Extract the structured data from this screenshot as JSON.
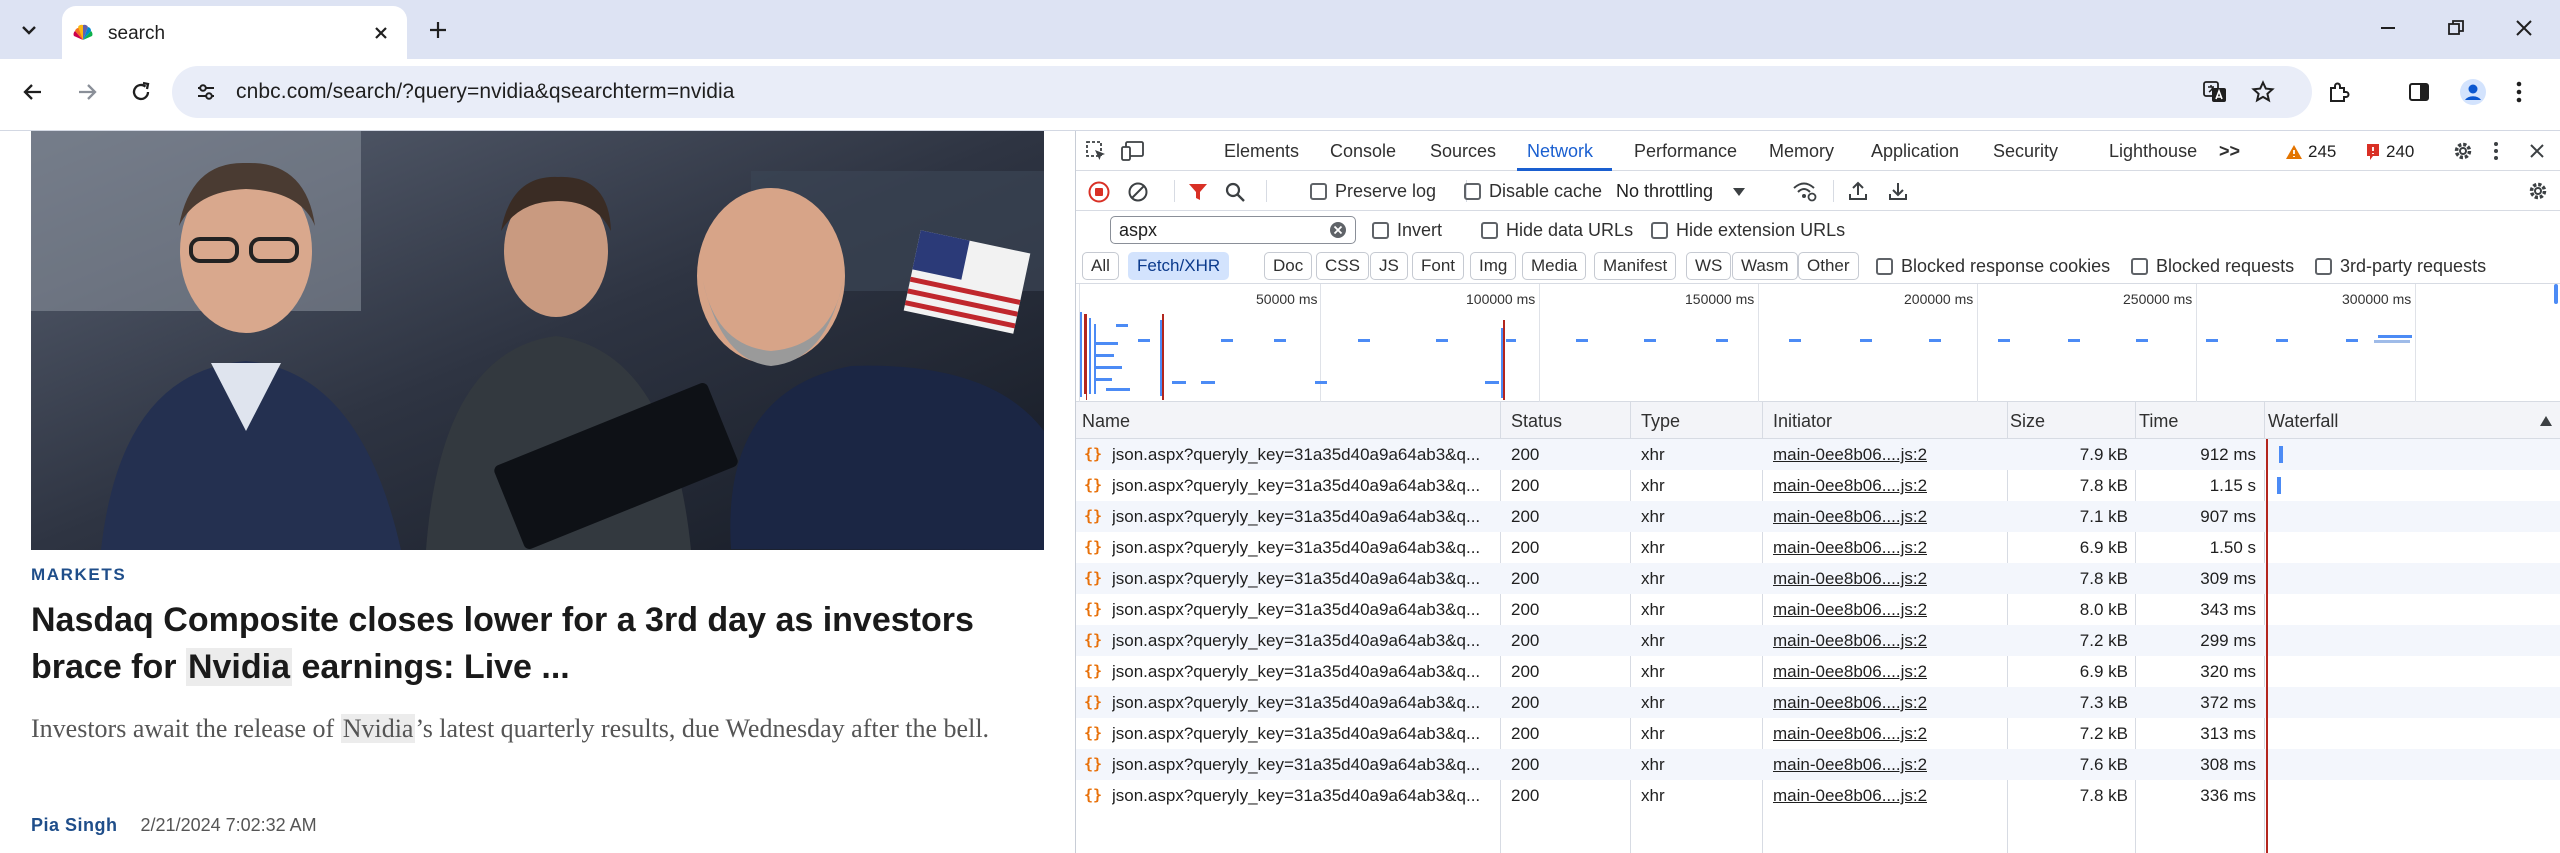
{
  "browser": {
    "tab": {
      "title": "search"
    },
    "url": "cnbc.com/search/?query=nvidia&qsearchterm=nvidia"
  },
  "article": {
    "category": "MARKETS",
    "headline_parts": [
      "Nasdaq Composite closes lower for a 3rd day as investors brace for ",
      "Nvidia",
      " earnings: Live ..."
    ],
    "description_parts": [
      "Investors await the release of ",
      "Nvidia",
      "’s latest quarterly results, due Wednesday after the bell."
    ],
    "author": "Pia Singh",
    "datetime": "2/21/2024 7:02:32 AM"
  },
  "devtools": {
    "tabs": [
      "Elements",
      "Console",
      "Sources",
      "Network",
      "Performance",
      "Memory",
      "Application",
      "Security",
      "Lighthouse"
    ],
    "active_tab": "Network",
    "more_tabs": ">>",
    "warnings_count": "245",
    "errors_count": "240",
    "toolbar": {
      "preserve_log": "Preserve log",
      "disable_cache": "Disable cache",
      "throttling": "No throttling"
    },
    "filter": {
      "value": "aspx",
      "invert": "Invert",
      "hide_data_urls": "Hide data URLs",
      "hide_extension_urls": "Hide extension URLs"
    },
    "type_filters": [
      "All",
      "Fetch/XHR",
      "Doc",
      "CSS",
      "JS",
      "Font",
      "Img",
      "Media",
      "Manifest",
      "WS",
      "Wasm",
      "Other"
    ],
    "active_type_filter": "Fetch/XHR",
    "blocked_response_cookies": "Blocked response cookies",
    "blocked_requests": "Blocked requests",
    "third_party_requests": "3rd-party requests",
    "overview_ticks": [
      "50000 ms",
      "100000 ms",
      "150000 ms",
      "200000 ms",
      "250000 ms",
      "300000 ms"
    ],
    "columns": [
      "Name",
      "Status",
      "Type",
      "Initiator",
      "Size",
      "Time",
      "Waterfall"
    ],
    "requests": [
      {
        "name": "json.aspx?queryly_key=31a35d40a9a64ab3&q...",
        "status": "200",
        "type": "xhr",
        "initiator": "main-0ee8b06....js:2",
        "size": "7.9 kB",
        "time": "912 ms"
      },
      {
        "name": "json.aspx?queryly_key=31a35d40a9a64ab3&q...",
        "status": "200",
        "type": "xhr",
        "initiator": "main-0ee8b06....js:2",
        "size": "7.8 kB",
        "time": "1.15 s"
      },
      {
        "name": "json.aspx?queryly_key=31a35d40a9a64ab3&q...",
        "status": "200",
        "type": "xhr",
        "initiator": "main-0ee8b06....js:2",
        "size": "7.1 kB",
        "time": "907 ms"
      },
      {
        "name": "json.aspx?queryly_key=31a35d40a9a64ab3&q...",
        "status": "200",
        "type": "xhr",
        "initiator": "main-0ee8b06....js:2",
        "size": "6.9 kB",
        "time": "1.50 s"
      },
      {
        "name": "json.aspx?queryly_key=31a35d40a9a64ab3&q...",
        "status": "200",
        "type": "xhr",
        "initiator": "main-0ee8b06....js:2",
        "size": "7.8 kB",
        "time": "309 ms"
      },
      {
        "name": "json.aspx?queryly_key=31a35d40a9a64ab3&q...",
        "status": "200",
        "type": "xhr",
        "initiator": "main-0ee8b06....js:2",
        "size": "8.0 kB",
        "time": "343 ms"
      },
      {
        "name": "json.aspx?queryly_key=31a35d40a9a64ab3&q...",
        "status": "200",
        "type": "xhr",
        "initiator": "main-0ee8b06....js:2",
        "size": "7.2 kB",
        "time": "299 ms"
      },
      {
        "name": "json.aspx?queryly_key=31a35d40a9a64ab3&q...",
        "status": "200",
        "type": "xhr",
        "initiator": "main-0ee8b06....js:2",
        "size": "6.9 kB",
        "time": "320 ms"
      },
      {
        "name": "json.aspx?queryly_key=31a35d40a9a64ab3&q...",
        "status": "200",
        "type": "xhr",
        "initiator": "main-0ee8b06....js:2",
        "size": "7.3 kB",
        "time": "372 ms"
      },
      {
        "name": "json.aspx?queryly_key=31a35d40a9a64ab3&q...",
        "status": "200",
        "type": "xhr",
        "initiator": "main-0ee8b06....js:2",
        "size": "7.2 kB",
        "time": "313 ms"
      },
      {
        "name": "json.aspx?queryly_key=31a35d40a9a64ab3&q...",
        "status": "200",
        "type": "xhr",
        "initiator": "main-0ee8b06....js:2",
        "size": "7.6 kB",
        "time": "308 ms"
      },
      {
        "name": "json.aspx?queryly_key=31a35d40a9a64ab3&q...",
        "status": "200",
        "type": "xhr",
        "initiator": "main-0ee8b06....js:2",
        "size": "7.8 kB",
        "time": "336 ms"
      }
    ]
  },
  "colors": {
    "accent_blue": "#1a5fd0",
    "cnbc_blue": "#1f4e8a",
    "xhr_orange": "#e8710a",
    "error_red": "#d93025",
    "warning_orange": "#e37400"
  }
}
